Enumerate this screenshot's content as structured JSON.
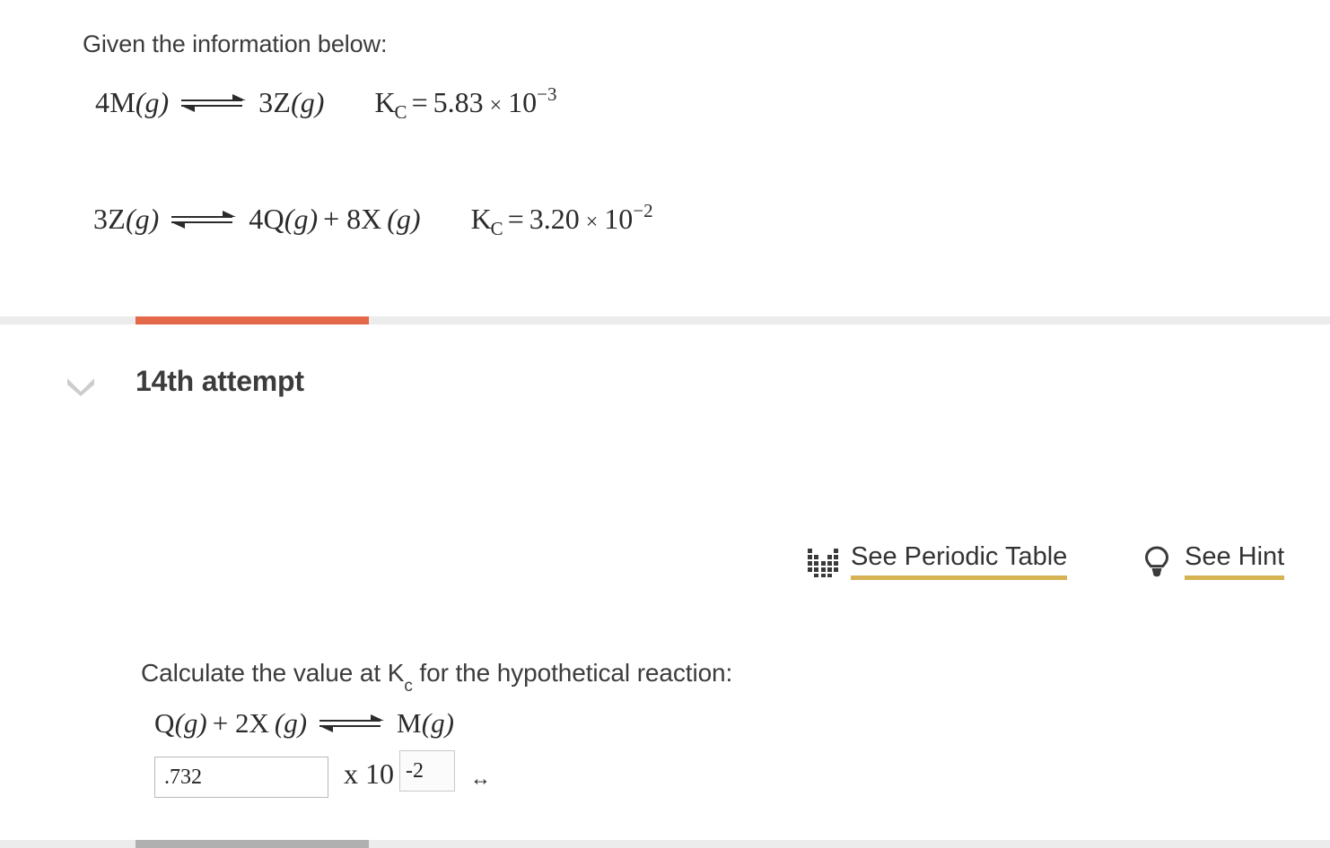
{
  "given": {
    "label": "Given the information below:",
    "equations": [
      {
        "left": "4M",
        "left_state": "(g)",
        "right": "3Z",
        "right_state": "(g)",
        "kc_symbol": "K",
        "kc_subscript": "C",
        "equals": "=",
        "coefficient": "5.83",
        "times": "×",
        "base": "10",
        "exponent": "−3"
      },
      {
        "left": "3Z",
        "left_state": "(g)",
        "right": "4Q",
        "right_state": "(g)",
        "right_plus": "+ 8X",
        "right_plus_state": "(g)",
        "kc_symbol": "K",
        "kc_subscript": "C",
        "equals": "=",
        "coefficient": "3.20",
        "times": "×",
        "base": "10",
        "exponent": "−2"
      }
    ]
  },
  "attempt": {
    "title": "14th attempt",
    "chevron_icon": "chevron-down-icon",
    "progress_color": "#e4694a",
    "track_color": "#ececec",
    "bottom_progress_color": "#b0b0b0"
  },
  "tools": {
    "periodic_table": {
      "label": "See Periodic Table",
      "icon": "periodic-table-icon"
    },
    "hint": {
      "label": "See Hint",
      "icon": "lightbulb-icon"
    },
    "underline_color": "#d6b253"
  },
  "question": {
    "prompt_before": "Calculate the value at K",
    "prompt_subscript": "c",
    "prompt_after": " for the hypothetical reaction:",
    "equation": {
      "left": "Q",
      "left_state": "(g)",
      "left_plus": "+ 2X",
      "left_plus_state": "(g)",
      "right": "M",
      "right_state": "(g)"
    }
  },
  "answer": {
    "mantissa_value": ".732",
    "mantissa_placeholder": "",
    "times_ten": "x 10",
    "exponent_value": "-2",
    "exponent_placeholder": "",
    "resize_icon": "↔"
  }
}
